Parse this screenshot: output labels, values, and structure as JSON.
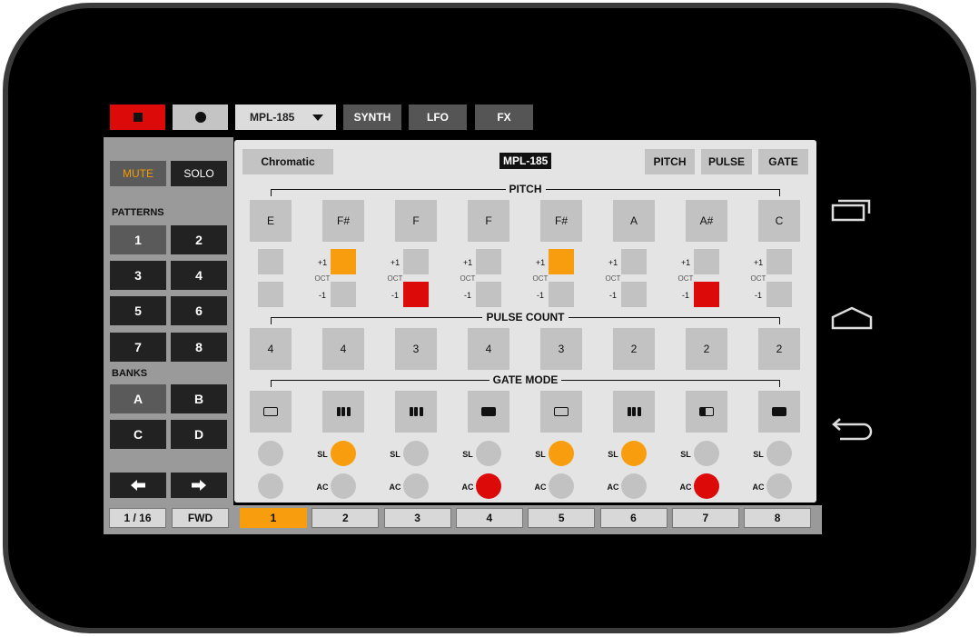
{
  "topbar": {
    "preset": "MPL-185",
    "tabs": [
      "SYNTH",
      "LFO",
      "FX"
    ]
  },
  "left": {
    "mute": "MUTE",
    "solo": "SOLO",
    "patterns_label": "PATTERNS",
    "patterns": [
      "1",
      "2",
      "3",
      "4",
      "5",
      "6",
      "7",
      "8"
    ],
    "selected_pattern": "1",
    "banks_label": "BANKS",
    "banks": [
      "A",
      "B",
      "C",
      "D"
    ],
    "selected_bank": "A",
    "rate": "1 / 16",
    "direction": "FWD"
  },
  "main": {
    "scale": "Chromatic",
    "title": "MPL-185",
    "mode_buttons": [
      "PITCH",
      "PULSE",
      "GATE"
    ],
    "pitch_label": "PITCH",
    "pitches": [
      "E",
      "F#",
      "F",
      "F",
      "F#",
      "A",
      "A#",
      "C"
    ],
    "oct_up_label": "+1",
    "oct_label": "OCT",
    "oct_down_label": "-1",
    "oct_up": [
      false,
      true,
      false,
      false,
      true,
      false,
      false,
      false
    ],
    "oct_down": [
      false,
      false,
      true,
      false,
      false,
      false,
      true,
      false
    ],
    "pulse_label": "PULSE COUNT",
    "pulses": [
      "4",
      "4",
      "3",
      "4",
      "3",
      "2",
      "2",
      "2"
    ],
    "gate_label": "GATE MODE",
    "gate_modes": [
      "single",
      "multi",
      "multi",
      "hold",
      "single",
      "multi",
      "first",
      "hold"
    ],
    "slide_label": "SL",
    "accent_label": "AC",
    "slide": [
      false,
      true,
      false,
      false,
      true,
      true,
      false,
      false
    ],
    "accent": [
      false,
      false,
      false,
      true,
      false,
      false,
      true,
      false
    ]
  },
  "steps": [
    "1",
    "2",
    "3",
    "4",
    "5",
    "6",
    "7",
    "8"
  ],
  "active_step": "1",
  "colors": {
    "accent_orange": "#f89d0e",
    "accent_red": "#dd0a0a"
  }
}
